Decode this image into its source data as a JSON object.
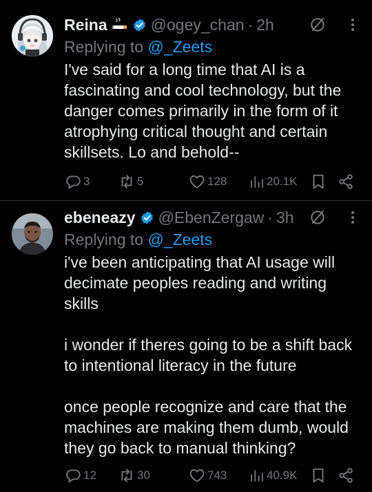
{
  "tweets": [
    {
      "display_name": "Reina",
      "name_emoji": "cigarette-emoji",
      "handle": "@ogey_chan",
      "separator": "·",
      "time": "2h",
      "replying_prefix": "Replying to ",
      "replying_to": "@_Zeets",
      "text": "I've said for a long time that AI is a fascinating and cool technology, but the danger comes primarily in the form of it atrophying critical thought and certain skillsets. Lo and behold--",
      "replies": "3",
      "reposts": "5",
      "likes": "128",
      "views": "20.1K"
    },
    {
      "display_name": "ebeneazy",
      "handle": "@EbenZergaw",
      "separator": "·",
      "time": "3h",
      "replying_prefix": "Replying to ",
      "replying_to": "@_Zeets",
      "text": "i've been anticipating that AI usage will decimate peoples reading and writing skills\n\ni wonder if theres going to be a shift back to intentional literacy in the future\n\nonce people recognize and care that the machines are making them dumb, would they go back to manual thinking?",
      "replies": "12",
      "reposts": "30",
      "likes": "743",
      "views": "40.9K"
    }
  ],
  "colors": {
    "background": "#000000",
    "text": "#e7e9ea",
    "muted": "#71767b",
    "link": "#1d9bf0",
    "divider": "#2f3336"
  }
}
